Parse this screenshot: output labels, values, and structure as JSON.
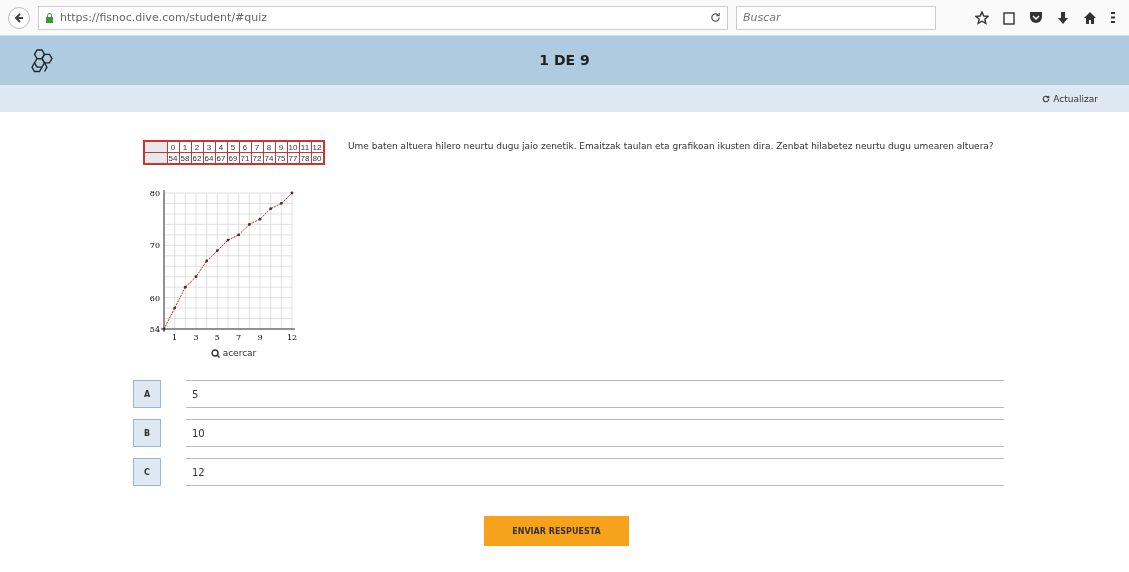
{
  "browser": {
    "url": "https://fisnoc.dive.com/student/#quiz",
    "search_placeholder": "Buscar"
  },
  "header": {
    "progress": "1 DE 9"
  },
  "toolbar": {
    "refresh_label": "Actualizar"
  },
  "question": {
    "text": "Ume baten altuera hilero neurtu dugu jaio zenetik. Emaitzak taulan eta grafikoan ikusten dira. Zenbat hilabetez neurtu dugu umearen altuera?",
    "table": {
      "row_1": [
        "0",
        "1",
        "2",
        "3",
        "4",
        "5",
        "6",
        "7",
        "8",
        "9",
        "10",
        "11",
        "12"
      ],
      "row_2": [
        "54",
        "58",
        "62",
        "64",
        "67",
        "69",
        "71",
        "72",
        "74",
        "75",
        "77",
        "78",
        "80"
      ]
    },
    "chart_data": {
      "type": "line",
      "x": [
        0,
        1,
        2,
        3,
        4,
        5,
        6,
        7,
        8,
        9,
        10,
        11,
        12
      ],
      "series": [
        {
          "color": "#cc2222",
          "line_style": "dashed",
          "values": [
            54,
            58,
            62,
            64,
            67,
            69,
            71,
            72,
            74,
            75,
            77,
            78,
            80
          ]
        }
      ],
      "grid": true,
      "xlim": [
        0,
        12
      ],
      "ylim": [
        54,
        80
      ],
      "xticks": [
        1,
        3,
        5,
        7,
        9,
        12
      ],
      "yticks": [
        54,
        60,
        70,
        80
      ]
    },
    "zoom_link": "acercar"
  },
  "answers": [
    {
      "letter": "A",
      "text": "5",
      "selected": false
    },
    {
      "letter": "B",
      "text": "10",
      "selected": false
    },
    {
      "letter": "C",
      "text": "12",
      "selected": false
    }
  ],
  "submit": "ENVIAR RESPUESTA"
}
